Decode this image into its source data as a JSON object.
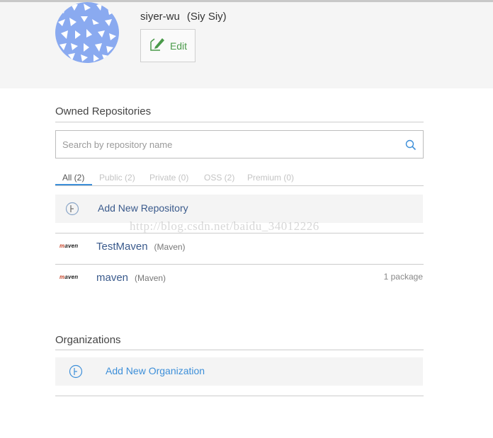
{
  "profile": {
    "username": "siyer-wu",
    "fullname": "(Siy Siy)",
    "edit_label": "Edit",
    "avatar_icon": "identicon-avatar",
    "avatar_color": "#8aaaf0"
  },
  "owned": {
    "title": "Owned Repositories",
    "search_placeholder": "Search by repository name",
    "tabs": [
      {
        "label": "All (2)",
        "active": true
      },
      {
        "label": "Public (2)",
        "active": false
      },
      {
        "label": "Private (0)",
        "active": false
      },
      {
        "label": "OSS (2)",
        "active": false
      },
      {
        "label": "Premium (0)",
        "active": false
      }
    ],
    "add_label": "Add New Repository",
    "repos": [
      {
        "logo": "maven",
        "name": "TestMaven",
        "type": "(Maven)",
        "count": ""
      },
      {
        "logo": "maven",
        "name": "maven",
        "type": "(Maven)",
        "count": "1 package"
      }
    ]
  },
  "organizations": {
    "title": "Organizations",
    "add_label": "Add New Organization"
  },
  "watermark": "http://blog.csdn.net/baidu_34012226",
  "colors": {
    "accent_blue": "#3d8fd9",
    "edit_green": "#4a9a4a",
    "repo_link": "#3a5a8c"
  }
}
